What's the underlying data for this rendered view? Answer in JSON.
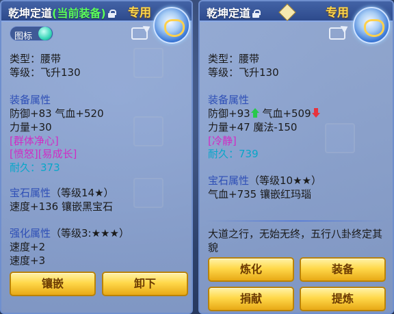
{
  "left_panel": {
    "title_name": "乾坤定道",
    "title_status": "(当前装备)",
    "exclusive": "专用",
    "icon_toggle_label": "图标",
    "type": "类型：腰带",
    "level": "等级：飞升130",
    "equip_attr_title": "装备属性",
    "equip_line1": "防御+83 气血+520",
    "equip_line2": "力量+30",
    "special1": "[群体净心]",
    "special2": "[愤怒][易成长]",
    "durability": "耐久：373",
    "gem_title": "宝石属性",
    "gem_level": "（等级14★）",
    "gem_line": "速度+136 镶嵌黑宝石",
    "enhance_title": "强化属性",
    "enhance_level": "（等级3:★★★）",
    "enhance_line1": "速度+2",
    "enhance_line2": "速度+3",
    "buttons": {
      "inlay": "镶嵌",
      "unequip": "卸下"
    }
  },
  "right_panel": {
    "title_name": "乾坤定道",
    "exclusive": "专用",
    "type": "类型：腰带",
    "level": "等级：飞升130",
    "equip_attr_title": "装备属性",
    "def": "防御+93",
    "hp": "气血+509",
    "equip_line2": "力量+47 魔法-150",
    "special1": "[冷静]",
    "durability": "耐久：739",
    "gem_title": "宝石属性",
    "gem_level": "（等级10★★）",
    "gem_line": "气血+735 镶嵌红玛瑙",
    "description": "大道之行，无始无终，五行八卦终定其貌",
    "buttons": {
      "refine": "炼化",
      "equip": "装备",
      "donate": "捐献",
      "extract": "提炼"
    }
  },
  "icons": [
    "lock-icon",
    "share-icon",
    "item-icon",
    "up-arrow-icon",
    "down-arrow-icon",
    "seal-icon"
  ],
  "colors": {
    "title_bar": "#2d4a8c",
    "current_equip": "#5cff5c",
    "exclusive": "#ffd84a",
    "section": "#2e4fb6",
    "special": "#d12bc4",
    "durability": "#07a6c9",
    "button": "#ffd84a"
  }
}
